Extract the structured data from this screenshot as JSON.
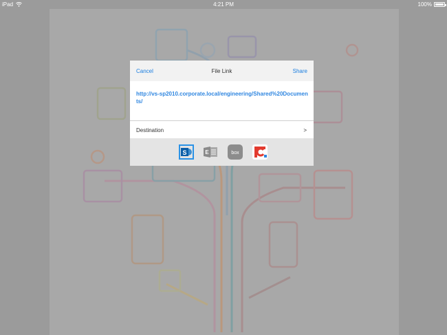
{
  "status_bar": {
    "device": "iPad",
    "time": "4:21 PM",
    "battery": "100%"
  },
  "dialog": {
    "cancel_label": "Cancel",
    "title": "File Link",
    "share_label": "Share",
    "link_url": "http://vs-sp2010.corporate.local/engineering/Shared%20Documents/",
    "destination_label": "Destination",
    "destination_chevron": ">",
    "services": [
      {
        "name": "sharepoint-icon",
        "selected": true
      },
      {
        "name": "exchange-icon",
        "selected": false
      },
      {
        "name": "box-icon",
        "selected": false
      },
      {
        "name": "citrix-icon",
        "selected": false
      }
    ],
    "box_text": "box"
  },
  "colors": {
    "accent": "#1a7ee0",
    "link": "#2f86e0",
    "overlay": "#9b9b9b"
  }
}
